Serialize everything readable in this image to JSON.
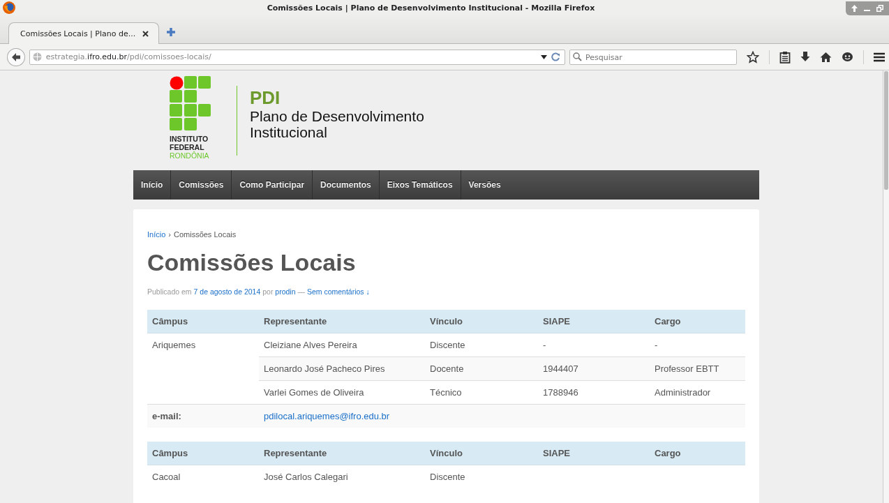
{
  "window": {
    "title": "Comissões Locais | Plano de Desenvolvimento Institucional - Mozilla Firefox"
  },
  "tabs": [
    {
      "label": "Comissões Locais | Plano de...",
      "selected": true
    }
  ],
  "address": {
    "host_prefix": "estrategia.",
    "domain": "ifro.edu.br",
    "path": "/pdi/comissoes-locais/"
  },
  "search": {
    "placeholder": "Pesquisar"
  },
  "site": {
    "logo_lines": [
      "INSTITUTO",
      "FEDERAL",
      "RONDÔNIA"
    ],
    "title": "PDI",
    "subtitle_lines": [
      "Plano de Desenvolvimento",
      "Institucional"
    ]
  },
  "menu": [
    {
      "label": "Início"
    },
    {
      "label": "Comissões"
    },
    {
      "label": "Como Participar"
    },
    {
      "label": "Documentos"
    },
    {
      "label": "Eixos Temáticos"
    },
    {
      "label": "Versões"
    }
  ],
  "breadcrumb": {
    "link": "Início",
    "separator": "›",
    "current": "Comissões Locais"
  },
  "page_title": "Comissões Locais",
  "meta": {
    "prefix": "Publicado em",
    "date": "7 de agosto de 2014",
    "by": "por",
    "author": "prodin",
    "dash": "—",
    "comments": "Sem comentários ↓"
  },
  "tables": [
    {
      "columns": [
        "Câmpus",
        "Representante",
        "Vínculo",
        "SIAPE",
        "Cargo"
      ],
      "rows": [
        {
          "cells": [
            "Ariquemes",
            "Cleiziane Alves Pereira",
            "Discente",
            "-",
            "-"
          ]
        },
        {
          "cells": [
            "",
            "Leonardo José Pacheco Pires",
            "Docente",
            "1944407",
            "Professor EBTT"
          ]
        },
        {
          "cells": [
            "",
            "Varlei Gomes de Oliveira",
            "Técnico",
            "1788946",
            "Administrador"
          ]
        }
      ],
      "email_label": "e-mail:",
      "email": "pdilocal.ariquemes@ifro.edu.br"
    },
    {
      "columns": [
        "Câmpus",
        "Representante",
        "Vínculo",
        "SIAPE",
        "Cargo"
      ],
      "rows": [
        {
          "cells": [
            "Cacoal",
            "José Carlos Calegari",
            "Discente"
          ]
        }
      ]
    }
  ]
}
